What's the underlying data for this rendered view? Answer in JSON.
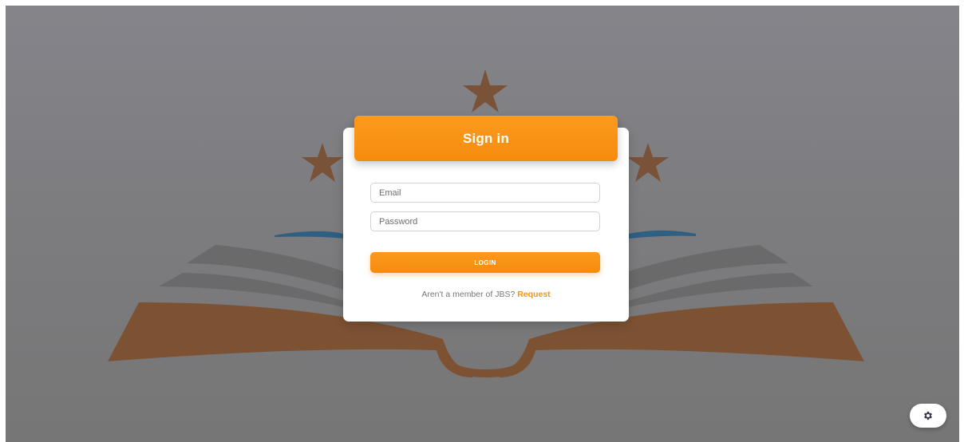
{
  "background": {
    "logo_colors": {
      "star": "#7a5237",
      "page_orange": "#7d5233",
      "page_gray": "#6a6a6a",
      "arc_blue": "#2f5f82"
    }
  },
  "login_card": {
    "title": "Sign in",
    "email": {
      "placeholder": "Email",
      "value": ""
    },
    "password": {
      "placeholder": "Password",
      "value": ""
    },
    "login_label": "LOGIN",
    "member_prompt": "Aren't a member of JBS?",
    "request_label": "Request"
  },
  "settings": {
    "icon": "gear-icon"
  },
  "colors": {
    "accent": "#f7930f",
    "card_bg": "#ffffff"
  }
}
